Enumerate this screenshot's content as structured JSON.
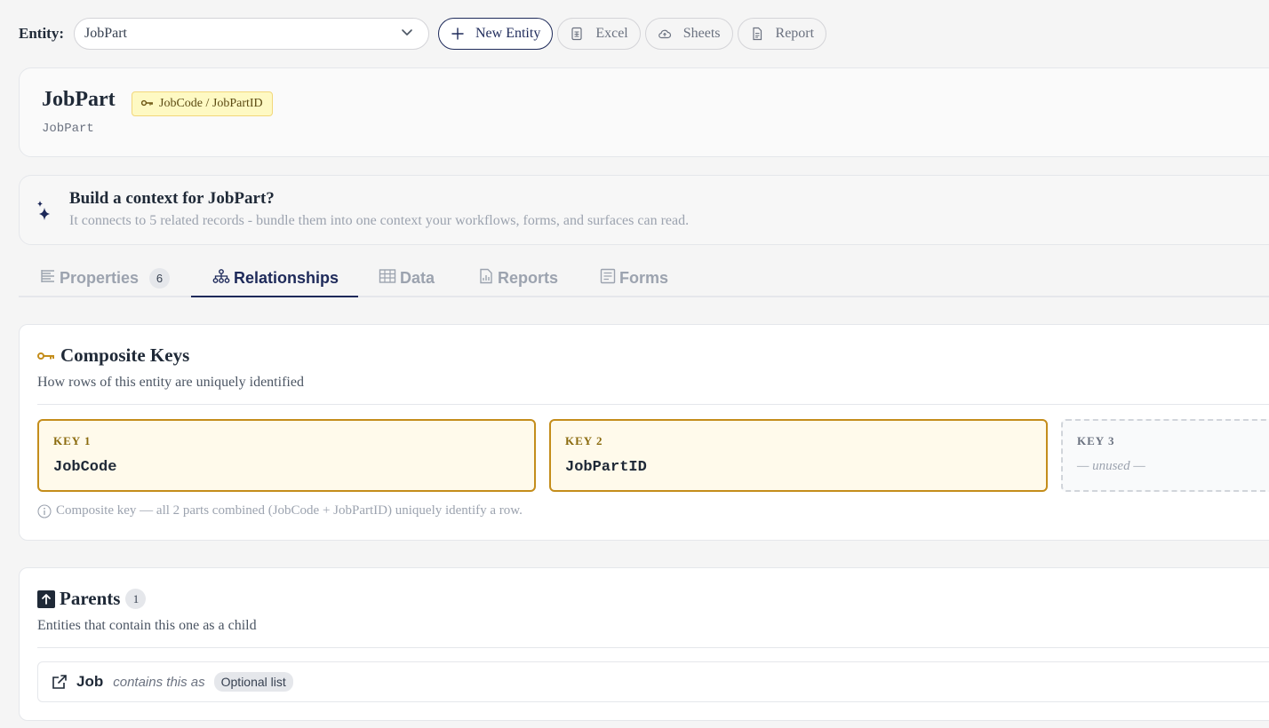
{
  "toolbar": {
    "entity_label": "Entity:",
    "selected_entity": "JobPart",
    "new_entity_label": "New Entity",
    "excel_label": "Excel",
    "sheets_label": "Sheets",
    "report_label": "Report"
  },
  "header": {
    "title": "JobPart",
    "key_badge": "JobCode / JobPartID",
    "subtitle": "JobPart"
  },
  "context": {
    "title": "Build a context for JobPart?",
    "description": "It connects to 5 related records - bundle them into one context your workflows, forms, and surfaces can read."
  },
  "tabs": [
    {
      "label": "Properties",
      "count": "6",
      "active": false
    },
    {
      "label": "Relationships",
      "active": true
    },
    {
      "label": "Data",
      "active": false
    },
    {
      "label": "Reports",
      "active": false
    },
    {
      "label": "Forms",
      "active": false
    }
  ],
  "composite_keys": {
    "title": "Composite Keys",
    "description": "How rows of this entity are uniquely identified",
    "keys": [
      {
        "label": "KEY 1",
        "value": "JobCode"
      },
      {
        "label": "KEY 2",
        "value": "JobPartID"
      },
      {
        "label": "KEY 3",
        "value": "— unused —"
      }
    ],
    "note": "Composite key — all 2 parts combined (JobCode + JobPartID) uniquely identify a row."
  },
  "parents": {
    "title": "Parents",
    "count": "1",
    "description": "Entities that contain this one as a child",
    "items": [
      {
        "name": "Job",
        "relation": "contains this as",
        "badge": "Optional list"
      }
    ]
  },
  "colors": {
    "accent": "#1e2a5a",
    "key_border": "#c48d1b",
    "key_fill": "#fffaeb"
  }
}
